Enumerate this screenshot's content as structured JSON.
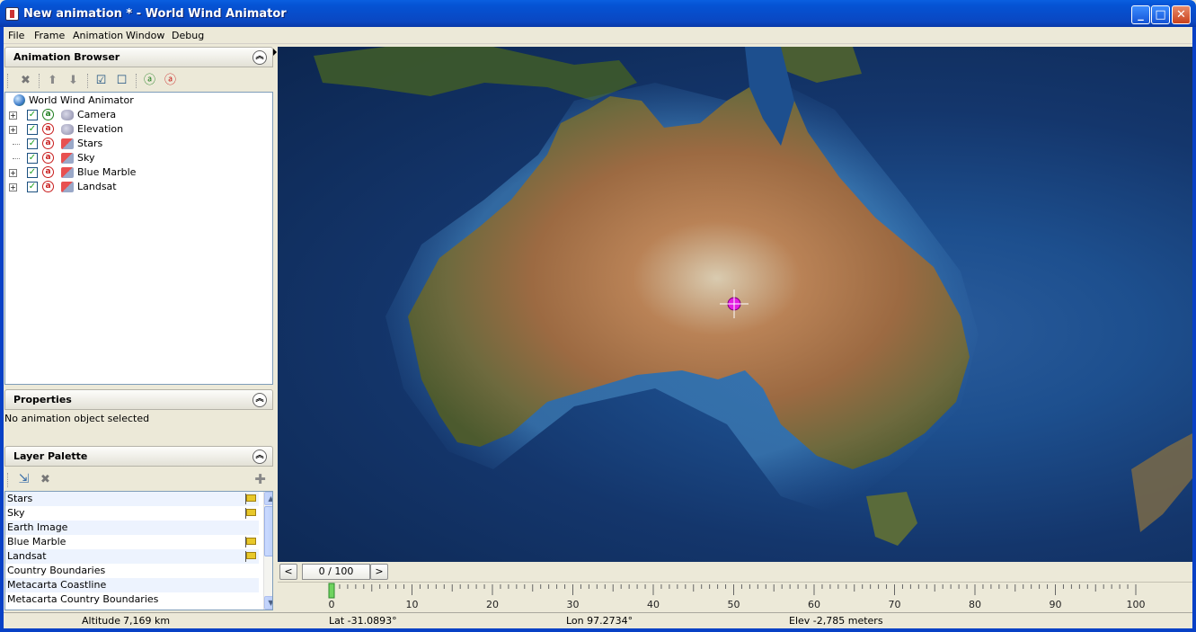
{
  "window": {
    "title": "New animation * - World Wind Animator",
    "controls": {
      "minimize": "_",
      "maximize": "□",
      "close": "✕"
    }
  },
  "menu": [
    "File",
    "Frame",
    "Animation",
    "Window",
    "Debug"
  ],
  "animation_browser": {
    "title": "Animation Browser",
    "toolbar_icons": [
      "delete-icon",
      "move-up-icon",
      "move-down-icon",
      "select-all-icon",
      "select-none-icon",
      "enable-all-icon",
      "disable-all-icon"
    ],
    "root_label": "World Wind Animator",
    "items": [
      {
        "label": "Camera",
        "expandable": true,
        "checked": true,
        "active": "green",
        "icon": "camera"
      },
      {
        "label": "Elevation",
        "expandable": true,
        "checked": true,
        "active": "red",
        "icon": "elevation"
      },
      {
        "label": "Stars",
        "expandable": false,
        "checked": true,
        "active": "red",
        "icon": "layer"
      },
      {
        "label": "Sky",
        "expandable": false,
        "checked": true,
        "active": "red",
        "icon": "layer"
      },
      {
        "label": "Blue Marble",
        "expandable": true,
        "checked": true,
        "active": "red",
        "icon": "layer"
      },
      {
        "label": "Landsat",
        "expandable": true,
        "checked": true,
        "active": "red",
        "icon": "layer"
      }
    ]
  },
  "properties": {
    "title": "Properties",
    "empty_text": "No animation object selected"
  },
  "layer_palette": {
    "title": "Layer Palette",
    "layers": [
      {
        "name": "Stars",
        "flag": true
      },
      {
        "name": "Sky",
        "flag": true
      },
      {
        "name": "Earth Image",
        "flag": false
      },
      {
        "name": "Blue Marble",
        "flag": true
      },
      {
        "name": "Landsat",
        "flag": true
      },
      {
        "name": "Country Boundaries",
        "flag": false
      },
      {
        "name": "Metacarta Coastline",
        "flag": false
      },
      {
        "name": "Metacarta Country Boundaries",
        "flag": false
      }
    ]
  },
  "timeline": {
    "prev": "<",
    "next": ">",
    "frame_display": "0 / 100",
    "current_frame": 0,
    "min": 0,
    "max": 100,
    "tick_labels": [
      "0",
      "10",
      "20",
      "30",
      "40",
      "50",
      "60",
      "70",
      "80",
      "90",
      "100"
    ]
  },
  "status": {
    "altitude_label": "Altitude",
    "altitude_value": "7,169 km",
    "lat": "Lat -31.0893°",
    "lon": "Lon 97.2734°",
    "elev": "Elev  -2,785 meters"
  }
}
